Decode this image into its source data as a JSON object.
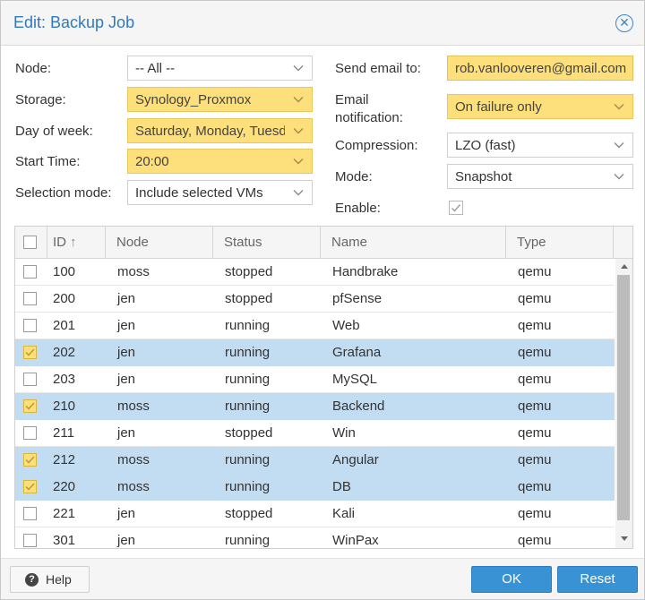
{
  "window": {
    "title": "Edit: Backup Job",
    "close_icon": "close-icon"
  },
  "form": {
    "node": {
      "label": "Node:",
      "value": "-- All --"
    },
    "storage": {
      "label": "Storage:",
      "value": "Synology_Proxmox"
    },
    "day_of_week": {
      "label": "Day of week:",
      "value": "Saturday, Monday, Tuesday"
    },
    "start_time": {
      "label": "Start Time:",
      "value": "20:00"
    },
    "selection_mode": {
      "label": "Selection mode:",
      "value": "Include selected VMs"
    },
    "send_email": {
      "label": "Send email to:",
      "value": "rob.vanlooveren@gmail.com"
    },
    "email_notification": {
      "label_line1": "Email",
      "label_line2": "notification:",
      "value": "On failure only"
    },
    "compression": {
      "label": "Compression:",
      "value": "LZO (fast)"
    },
    "mode": {
      "label": "Mode:",
      "value": "Snapshot"
    },
    "enable": {
      "label": "Enable:",
      "checked": true
    }
  },
  "grid": {
    "columns": [
      "ID",
      "Node",
      "Status",
      "Name",
      "Type"
    ],
    "sort_indicator": "↑",
    "rows": [
      {
        "id": "100",
        "node": "moss",
        "status": "stopped",
        "name": "Handbrake",
        "type": "qemu",
        "selected": false
      },
      {
        "id": "200",
        "node": "jen",
        "status": "stopped",
        "name": "pfSense",
        "type": "qemu",
        "selected": false
      },
      {
        "id": "201",
        "node": "jen",
        "status": "running",
        "name": "Web",
        "type": "qemu",
        "selected": false
      },
      {
        "id": "202",
        "node": "jen",
        "status": "running",
        "name": "Grafana",
        "type": "qemu",
        "selected": true
      },
      {
        "id": "203",
        "node": "jen",
        "status": "running",
        "name": "MySQL",
        "type": "qemu",
        "selected": false
      },
      {
        "id": "210",
        "node": "moss",
        "status": "running",
        "name": "Backend",
        "type": "qemu",
        "selected": true
      },
      {
        "id": "211",
        "node": "jen",
        "status": "stopped",
        "name": "Win",
        "type": "qemu",
        "selected": false
      },
      {
        "id": "212",
        "node": "moss",
        "status": "running",
        "name": "Angular",
        "type": "qemu",
        "selected": true
      },
      {
        "id": "220",
        "node": "moss",
        "status": "running",
        "name": "DB",
        "type": "qemu",
        "selected": true
      },
      {
        "id": "221",
        "node": "jen",
        "status": "stopped",
        "name": "Kali",
        "type": "qemu",
        "selected": false
      },
      {
        "id": "301",
        "node": "jen",
        "status": "running",
        "name": "WinPax",
        "type": "qemu",
        "selected": false
      }
    ]
  },
  "footer": {
    "help_label": "Help",
    "ok_label": "OK",
    "reset_label": "Reset"
  },
  "colors": {
    "accent": "#3892d4",
    "title": "#3079c2",
    "highlight_field": "#fde07b",
    "selected_row": "#c2ddf2"
  }
}
